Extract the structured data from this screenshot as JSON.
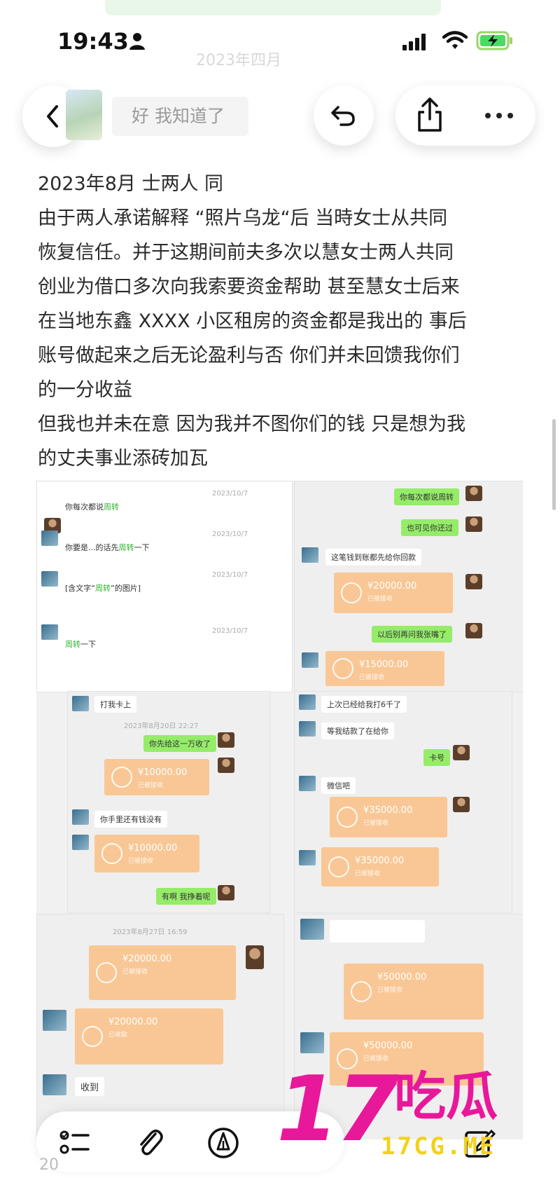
{
  "status_bar": {
    "time": "19:43"
  },
  "faint_header": "2023年四月",
  "nav": {
    "back_icon": "chevron-left-icon",
    "title": "好 我知道了",
    "undo_icon": "undo-icon",
    "share_icon": "share-icon",
    "more_icon": "more-horizontal-icon"
  },
  "body_text": {
    "line1": "2023年8月                                         士两人 同",
    "line2": "由于两人承诺解释 “照片乌龙“后 当時女士从共同",
    "line3": "恢复信任。并于这期间前夫多次以慧女士两人共同",
    "line4": "创业为借口多次向我索要资金帮助 甚至慧女士后来",
    "line5": "在当地东鑫 XXXX 小区租房的资金都是我出的 事后",
    "line6": "账号做起来之后无论盈利与否 你们并未回馈我你们",
    "line7": "的一分收益",
    "line8": "但我也并未在意 因为我并不图你们的钱 只是想为我",
    "line9": "的丈夫事业添砖加瓦"
  },
  "chat_panels": {
    "p1": {
      "ts1": "2023/10/7",
      "ts2": "2023/10/7",
      "ts3": "2023/10/7",
      "ts4": "2023/10/7",
      "msg1_pre": "你每次都说",
      "msg1_hl": "周转",
      "msg2_pre": "你要是...的话先",
      "msg2_hl": "周转",
      "msg2_post": "一下",
      "msg3_pre": "[含文字“",
      "msg3_hl": "周转",
      "msg3_post": "”的图片]",
      "msg4_hl": "周转",
      "msg4_post": "一下"
    },
    "p2": {
      "m1": "你每次都说周转",
      "m2": "也可见你还过",
      "m3": "这笔钱到账都先给你回款",
      "t1_amt": "¥20000.00",
      "t1_sub": "已被接收",
      "m4": "以后别再问我张嘴了",
      "t2_amt": "¥15000.00",
      "t2_sub": "已被接收"
    },
    "p3": {
      "m1": "打我卡上",
      "ts": "2023年8月20日 22:27",
      "m2": "你先给这一万收了",
      "t1_amt": "¥10000.00",
      "t1_sub": "已被接收",
      "m3": "你手里还有钱没有",
      "t2_amt": "¥10000.00",
      "t2_sub": "已被接收",
      "m4": "有啊 我挣着呢"
    },
    "p4": {
      "m1": "上次已经给我打6千了",
      "m2": "等我结款了在给你",
      "m3": "卡号",
      "m4": "微信吧",
      "t1_amt": "¥35000.00",
      "t1_sub": "已被接收",
      "t2_amt": "¥35000.00",
      "t2_sub": "已被接收"
    },
    "p5": {
      "ts": "2023年8月27日 16:59",
      "t1_amt": "¥20000.00",
      "t1_sub": "已被接收",
      "t2_amt": "¥20000.00",
      "t2_sub": "已收款",
      "m1": "收到"
    },
    "p6": {
      "t1_amt": "¥50000.00",
      "t1_sub": "已被接收",
      "t2_amt": "¥50000.00",
      "t2_sub": "已被接收"
    }
  },
  "toolbar": {
    "checklist_icon": "checklist-icon",
    "attach_icon": "paperclip-icon",
    "markup_icon": "pen-markup-icon",
    "compose_icon": "compose-icon"
  },
  "bottom_cut_text": "20",
  "watermark": {
    "number": "17",
    "chars": "吃瓜",
    "url": "17CG.ME"
  }
}
